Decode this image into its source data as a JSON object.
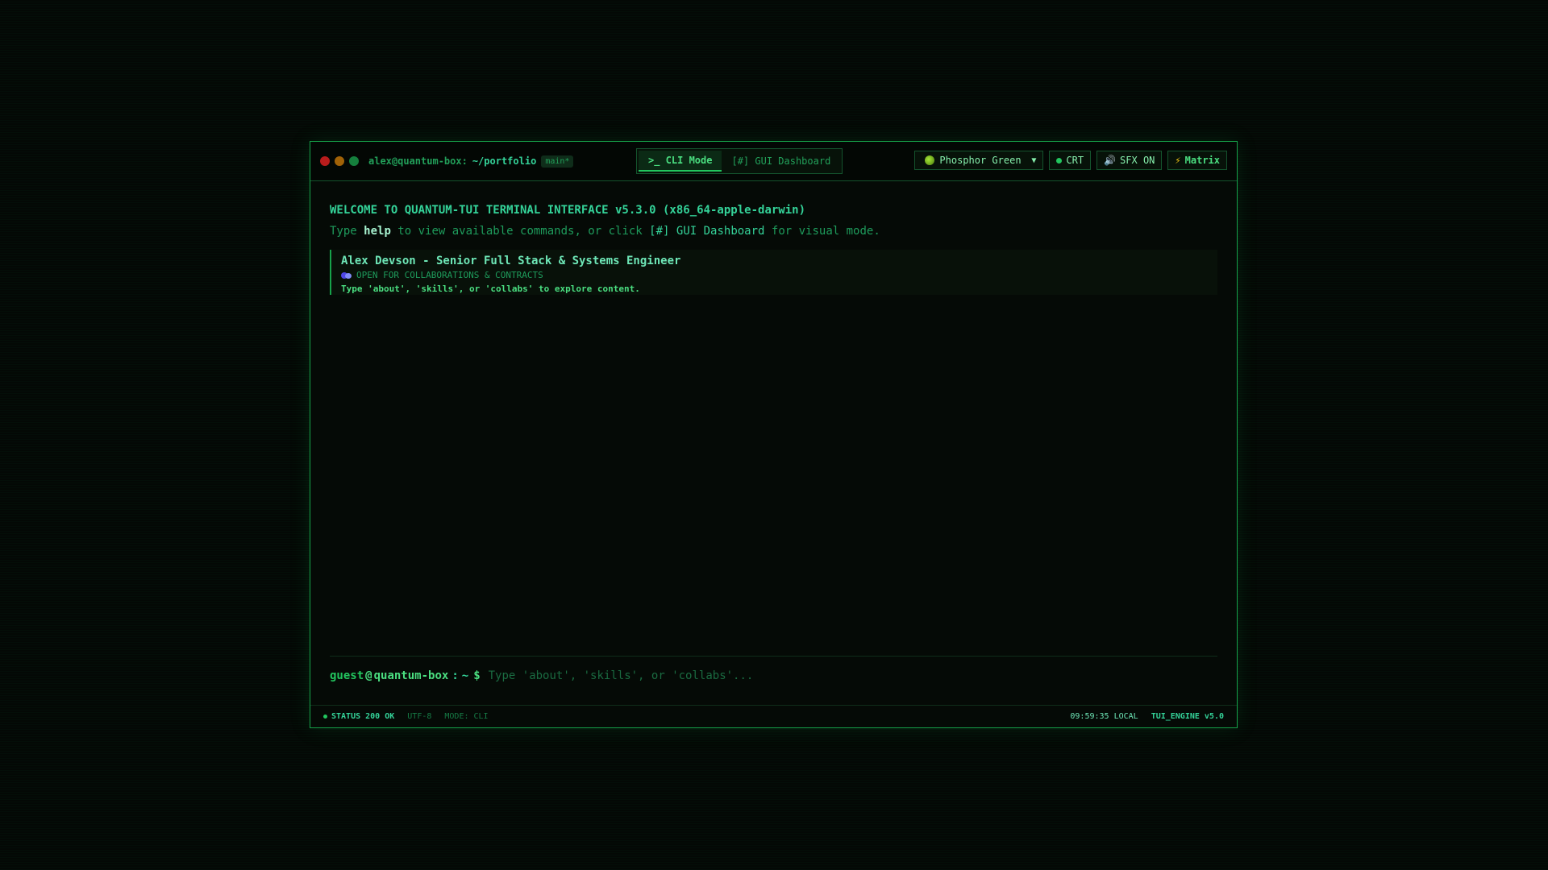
{
  "titlebar": {
    "user_host": "alex@quantum-box:",
    "path": "~/portfolio",
    "branch": "main*"
  },
  "tabs": [
    {
      "label": ">_ CLI Mode",
      "active": true
    },
    {
      "label": "[#] GUI Dashboard",
      "active": false
    }
  ],
  "controls": {
    "theme": {
      "selected": "Phosphor Green",
      "icon": "globe-icon"
    },
    "crt": "CRT",
    "sfx": {
      "label": "SFX ON",
      "icon": "speaker-icon"
    },
    "matrix": {
      "label": "Matrix",
      "icon": "lightning-icon"
    }
  },
  "content": {
    "welcome": "WELCOME TO QUANTUM-TUI TERMINAL INTERFACE v5.3.0 (x86_64-apple-darwin)",
    "hint": {
      "pre": "Type ",
      "keyword": "help",
      "mid": " to view available commands, or click ",
      "link": "[#] GUI Dashboard",
      "post": " for visual mode."
    },
    "card": {
      "title": "Alex Devson - Senior Full Stack & Systems Engineer",
      "status": "OPEN FOR COLLABORATIONS & CONTRACTS",
      "hint": "Type 'about', 'skills', or 'collabs' to explore content."
    }
  },
  "prompt": {
    "user": "guest",
    "at": "@",
    "host": "quantum-box",
    "colon": ":",
    "dir": "~",
    "symbol": "$",
    "placeholder": "Type 'about', 'skills', or 'collabs'..."
  },
  "statusbar": {
    "status": "STATUS 200 OK",
    "encoding": "UTF-8",
    "mode": "MODE: CLI",
    "time": "09:59:35 LOCAL",
    "engine": "TUI_ENGINE v5.0"
  },
  "colors": {
    "accent": "#22c55e",
    "border": "#16a34a",
    "background": "#050a06"
  }
}
